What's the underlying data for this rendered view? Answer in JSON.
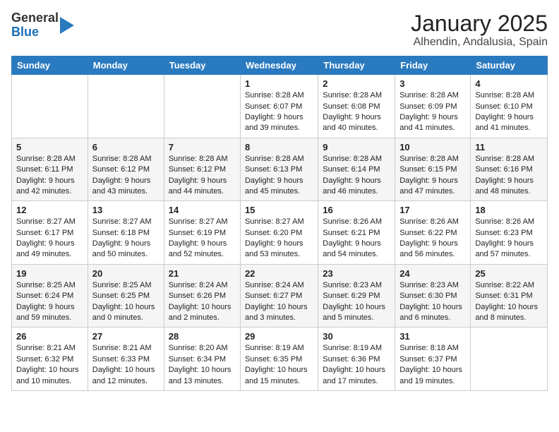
{
  "logo": {
    "general": "General",
    "blue": "Blue"
  },
  "title": "January 2025",
  "subtitle": "Alhendin, Andalusia, Spain",
  "days_of_week": [
    "Sunday",
    "Monday",
    "Tuesday",
    "Wednesday",
    "Thursday",
    "Friday",
    "Saturday"
  ],
  "weeks": [
    [
      {
        "day": "",
        "info": ""
      },
      {
        "day": "",
        "info": ""
      },
      {
        "day": "",
        "info": ""
      },
      {
        "day": "1",
        "info": "Sunrise: 8:28 AM\nSunset: 6:07 PM\nDaylight: 9 hours and 39 minutes."
      },
      {
        "day": "2",
        "info": "Sunrise: 8:28 AM\nSunset: 6:08 PM\nDaylight: 9 hours and 40 minutes."
      },
      {
        "day": "3",
        "info": "Sunrise: 8:28 AM\nSunset: 6:09 PM\nDaylight: 9 hours and 41 minutes."
      },
      {
        "day": "4",
        "info": "Sunrise: 8:28 AM\nSunset: 6:10 PM\nDaylight: 9 hours and 41 minutes."
      }
    ],
    [
      {
        "day": "5",
        "info": "Sunrise: 8:28 AM\nSunset: 6:11 PM\nDaylight: 9 hours and 42 minutes."
      },
      {
        "day": "6",
        "info": "Sunrise: 8:28 AM\nSunset: 6:12 PM\nDaylight: 9 hours and 43 minutes."
      },
      {
        "day": "7",
        "info": "Sunrise: 8:28 AM\nSunset: 6:12 PM\nDaylight: 9 hours and 44 minutes."
      },
      {
        "day": "8",
        "info": "Sunrise: 8:28 AM\nSunset: 6:13 PM\nDaylight: 9 hours and 45 minutes."
      },
      {
        "day": "9",
        "info": "Sunrise: 8:28 AM\nSunset: 6:14 PM\nDaylight: 9 hours and 46 minutes."
      },
      {
        "day": "10",
        "info": "Sunrise: 8:28 AM\nSunset: 6:15 PM\nDaylight: 9 hours and 47 minutes."
      },
      {
        "day": "11",
        "info": "Sunrise: 8:28 AM\nSunset: 6:16 PM\nDaylight: 9 hours and 48 minutes."
      }
    ],
    [
      {
        "day": "12",
        "info": "Sunrise: 8:27 AM\nSunset: 6:17 PM\nDaylight: 9 hours and 49 minutes."
      },
      {
        "day": "13",
        "info": "Sunrise: 8:27 AM\nSunset: 6:18 PM\nDaylight: 9 hours and 50 minutes."
      },
      {
        "day": "14",
        "info": "Sunrise: 8:27 AM\nSunset: 6:19 PM\nDaylight: 9 hours and 52 minutes."
      },
      {
        "day": "15",
        "info": "Sunrise: 8:27 AM\nSunset: 6:20 PM\nDaylight: 9 hours and 53 minutes."
      },
      {
        "day": "16",
        "info": "Sunrise: 8:26 AM\nSunset: 6:21 PM\nDaylight: 9 hours and 54 minutes."
      },
      {
        "day": "17",
        "info": "Sunrise: 8:26 AM\nSunset: 6:22 PM\nDaylight: 9 hours and 56 minutes."
      },
      {
        "day": "18",
        "info": "Sunrise: 8:26 AM\nSunset: 6:23 PM\nDaylight: 9 hours and 57 minutes."
      }
    ],
    [
      {
        "day": "19",
        "info": "Sunrise: 8:25 AM\nSunset: 6:24 PM\nDaylight: 9 hours and 59 minutes."
      },
      {
        "day": "20",
        "info": "Sunrise: 8:25 AM\nSunset: 6:25 PM\nDaylight: 10 hours and 0 minutes."
      },
      {
        "day": "21",
        "info": "Sunrise: 8:24 AM\nSunset: 6:26 PM\nDaylight: 10 hours and 2 minutes."
      },
      {
        "day": "22",
        "info": "Sunrise: 8:24 AM\nSunset: 6:27 PM\nDaylight: 10 hours and 3 minutes."
      },
      {
        "day": "23",
        "info": "Sunrise: 8:23 AM\nSunset: 6:29 PM\nDaylight: 10 hours and 5 minutes."
      },
      {
        "day": "24",
        "info": "Sunrise: 8:23 AM\nSunset: 6:30 PM\nDaylight: 10 hours and 6 minutes."
      },
      {
        "day": "25",
        "info": "Sunrise: 8:22 AM\nSunset: 6:31 PM\nDaylight: 10 hours and 8 minutes."
      }
    ],
    [
      {
        "day": "26",
        "info": "Sunrise: 8:21 AM\nSunset: 6:32 PM\nDaylight: 10 hours and 10 minutes."
      },
      {
        "day": "27",
        "info": "Sunrise: 8:21 AM\nSunset: 6:33 PM\nDaylight: 10 hours and 12 minutes."
      },
      {
        "day": "28",
        "info": "Sunrise: 8:20 AM\nSunset: 6:34 PM\nDaylight: 10 hours and 13 minutes."
      },
      {
        "day": "29",
        "info": "Sunrise: 8:19 AM\nSunset: 6:35 PM\nDaylight: 10 hours and 15 minutes."
      },
      {
        "day": "30",
        "info": "Sunrise: 8:19 AM\nSunset: 6:36 PM\nDaylight: 10 hours and 17 minutes."
      },
      {
        "day": "31",
        "info": "Sunrise: 8:18 AM\nSunset: 6:37 PM\nDaylight: 10 hours and 19 minutes."
      },
      {
        "day": "",
        "info": ""
      }
    ]
  ]
}
